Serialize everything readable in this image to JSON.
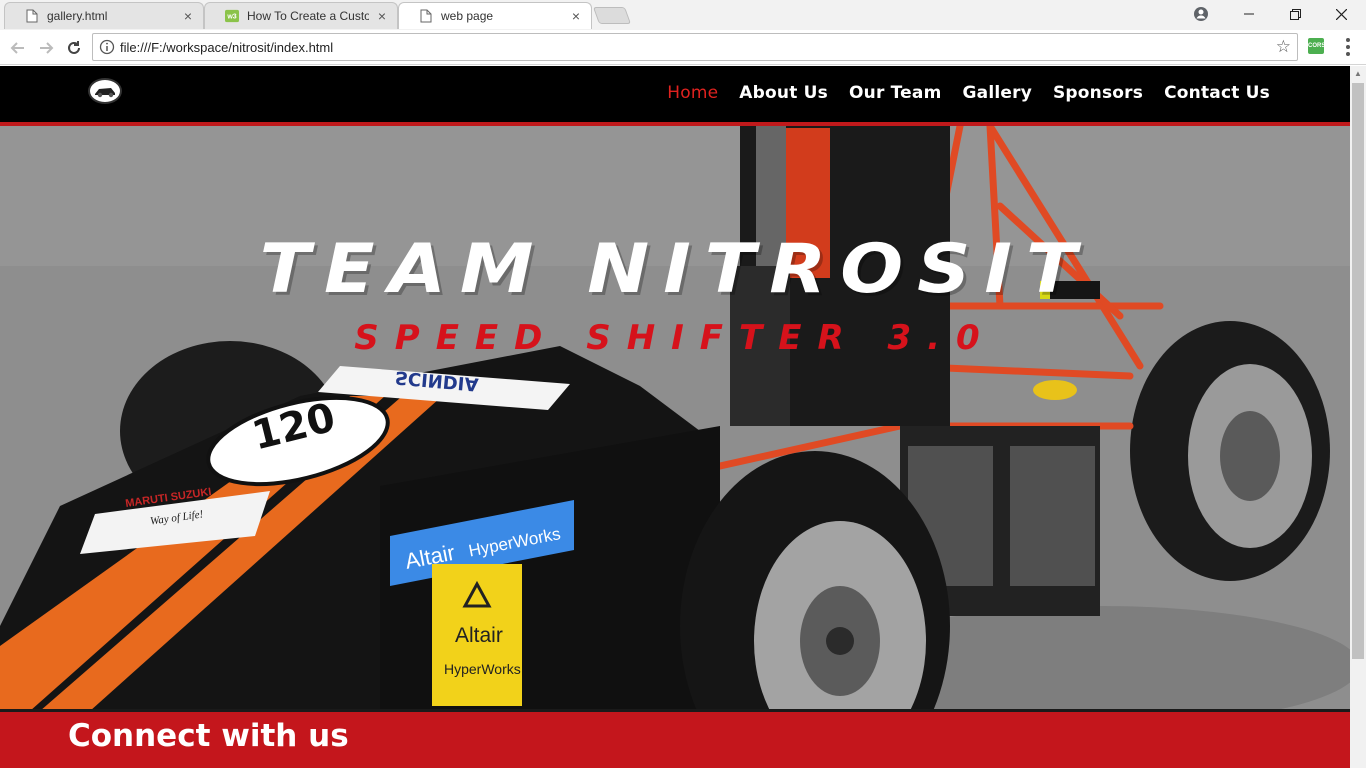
{
  "browser": {
    "tabs": [
      {
        "title": "gallery.html",
        "active": false,
        "icon": "file-icon"
      },
      {
        "title": "How To Create a Custom",
        "active": false,
        "icon": "w3-icon"
      },
      {
        "title": "web page",
        "active": true,
        "icon": "file-icon"
      }
    ],
    "close_glyph": "×",
    "url": "file:///F:/workspace/nitrosit/index.html",
    "extension_label": "CORS"
  },
  "site": {
    "nav": [
      {
        "label": "Home",
        "active": true
      },
      {
        "label": "About Us",
        "active": false
      },
      {
        "label": "Our Team",
        "active": false
      },
      {
        "label": "Gallery",
        "active": false
      },
      {
        "label": "Sponsors",
        "active": false
      },
      {
        "label": "Contact Us",
        "active": false
      }
    ],
    "hero_title": "TEAM NITROSIT",
    "hero_subtitle": "SPEED SHIFTER 3.0",
    "car_number": "120",
    "sponsor_altair": "Altair",
    "sponsor_hyperworks": "HyperWorks",
    "sponsor_maruti": "MARUTI SUZUKI",
    "sponsor_maruti_tagline": "Way of Life!",
    "sponsor_scindia": "SCINDIA",
    "connect_heading": "Connect with us",
    "accent_color": "#c4161c"
  }
}
